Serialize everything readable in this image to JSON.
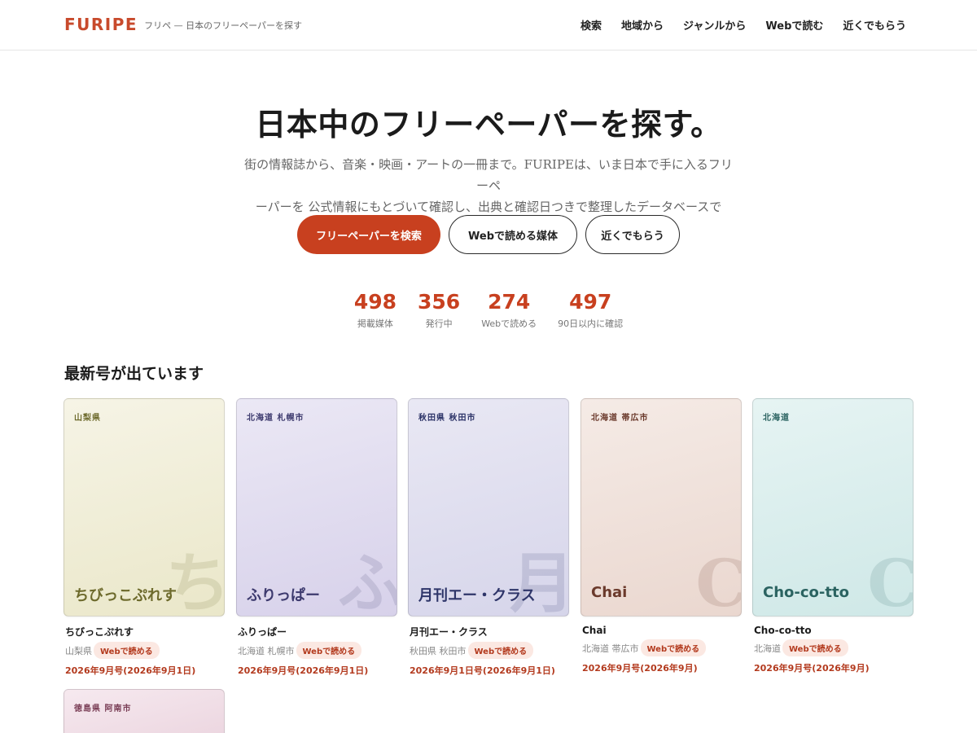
{
  "header": {
    "logo": "FURIPE",
    "tagline": "フリペ — 日本のフリーペーパーを探す",
    "nav": [
      "検索",
      "地域から",
      "ジャンルから",
      "Webで読む",
      "近くでもらう"
    ]
  },
  "hero": {
    "title": "日本中のフリーペーパーを探す。",
    "description_line1": "街の情報誌から、音楽・映画・アートの一冊まで。FURIPEは、いま日本で手に入るフリーペ",
    "description_line2": "ーパーを 公式情報にもとづいて確認し、出典と確認日つきで整理したデータベースです。",
    "buttons": {
      "search": "フリーペーパーを検索",
      "web": "Webで読める媒体",
      "near": "近くでもらう"
    }
  },
  "stats": [
    {
      "value": "498",
      "label": "掲載媒体"
    },
    {
      "value": "356",
      "label": "発行中"
    },
    {
      "value": "274",
      "label": "Webで読める"
    },
    {
      "value": "497",
      "label": "90日以内に確認"
    }
  ],
  "latest": {
    "title": "最新号が出ています",
    "web_badge": "Webで読める",
    "cards": [
      {
        "region_tag": "山梨県",
        "cover_title": "ちびっこぷれす",
        "glyph": "ち",
        "name": "ちびっこぷれす",
        "region": "山梨県",
        "issue": "2026年9月号(2026年9月1日)"
      },
      {
        "region_tag": "北海道 札幌市",
        "cover_title": "ふりっぱー",
        "glyph": "ふ",
        "name": "ふりっぱー",
        "region": "北海道 札幌市",
        "issue": "2026年9月号(2026年9月1日)"
      },
      {
        "region_tag": "秋田県 秋田市",
        "cover_title": "月刊エー・クラス",
        "glyph": "月",
        "name": "月刊エー・クラス",
        "region": "秋田県 秋田市",
        "issue": "2026年9月1日号(2026年9月1日)"
      },
      {
        "region_tag": "北海道 帯広市",
        "cover_title": "Chai",
        "glyph": "C",
        "name": "Chai",
        "region": "北海道 帯広市",
        "issue": "2026年9月号(2026年9月)"
      },
      {
        "region_tag": "北海道",
        "cover_title": "Cho-co-tto",
        "glyph": "C",
        "name": "Cho-co-tto",
        "region": "北海道",
        "issue": "2026年9月号(2026年9月)"
      },
      {
        "region_tag": "徳島県 阿南市"
      }
    ]
  },
  "colors": {
    "accent": "#c8401f",
    "badge_bg": "#fbe8e2"
  }
}
